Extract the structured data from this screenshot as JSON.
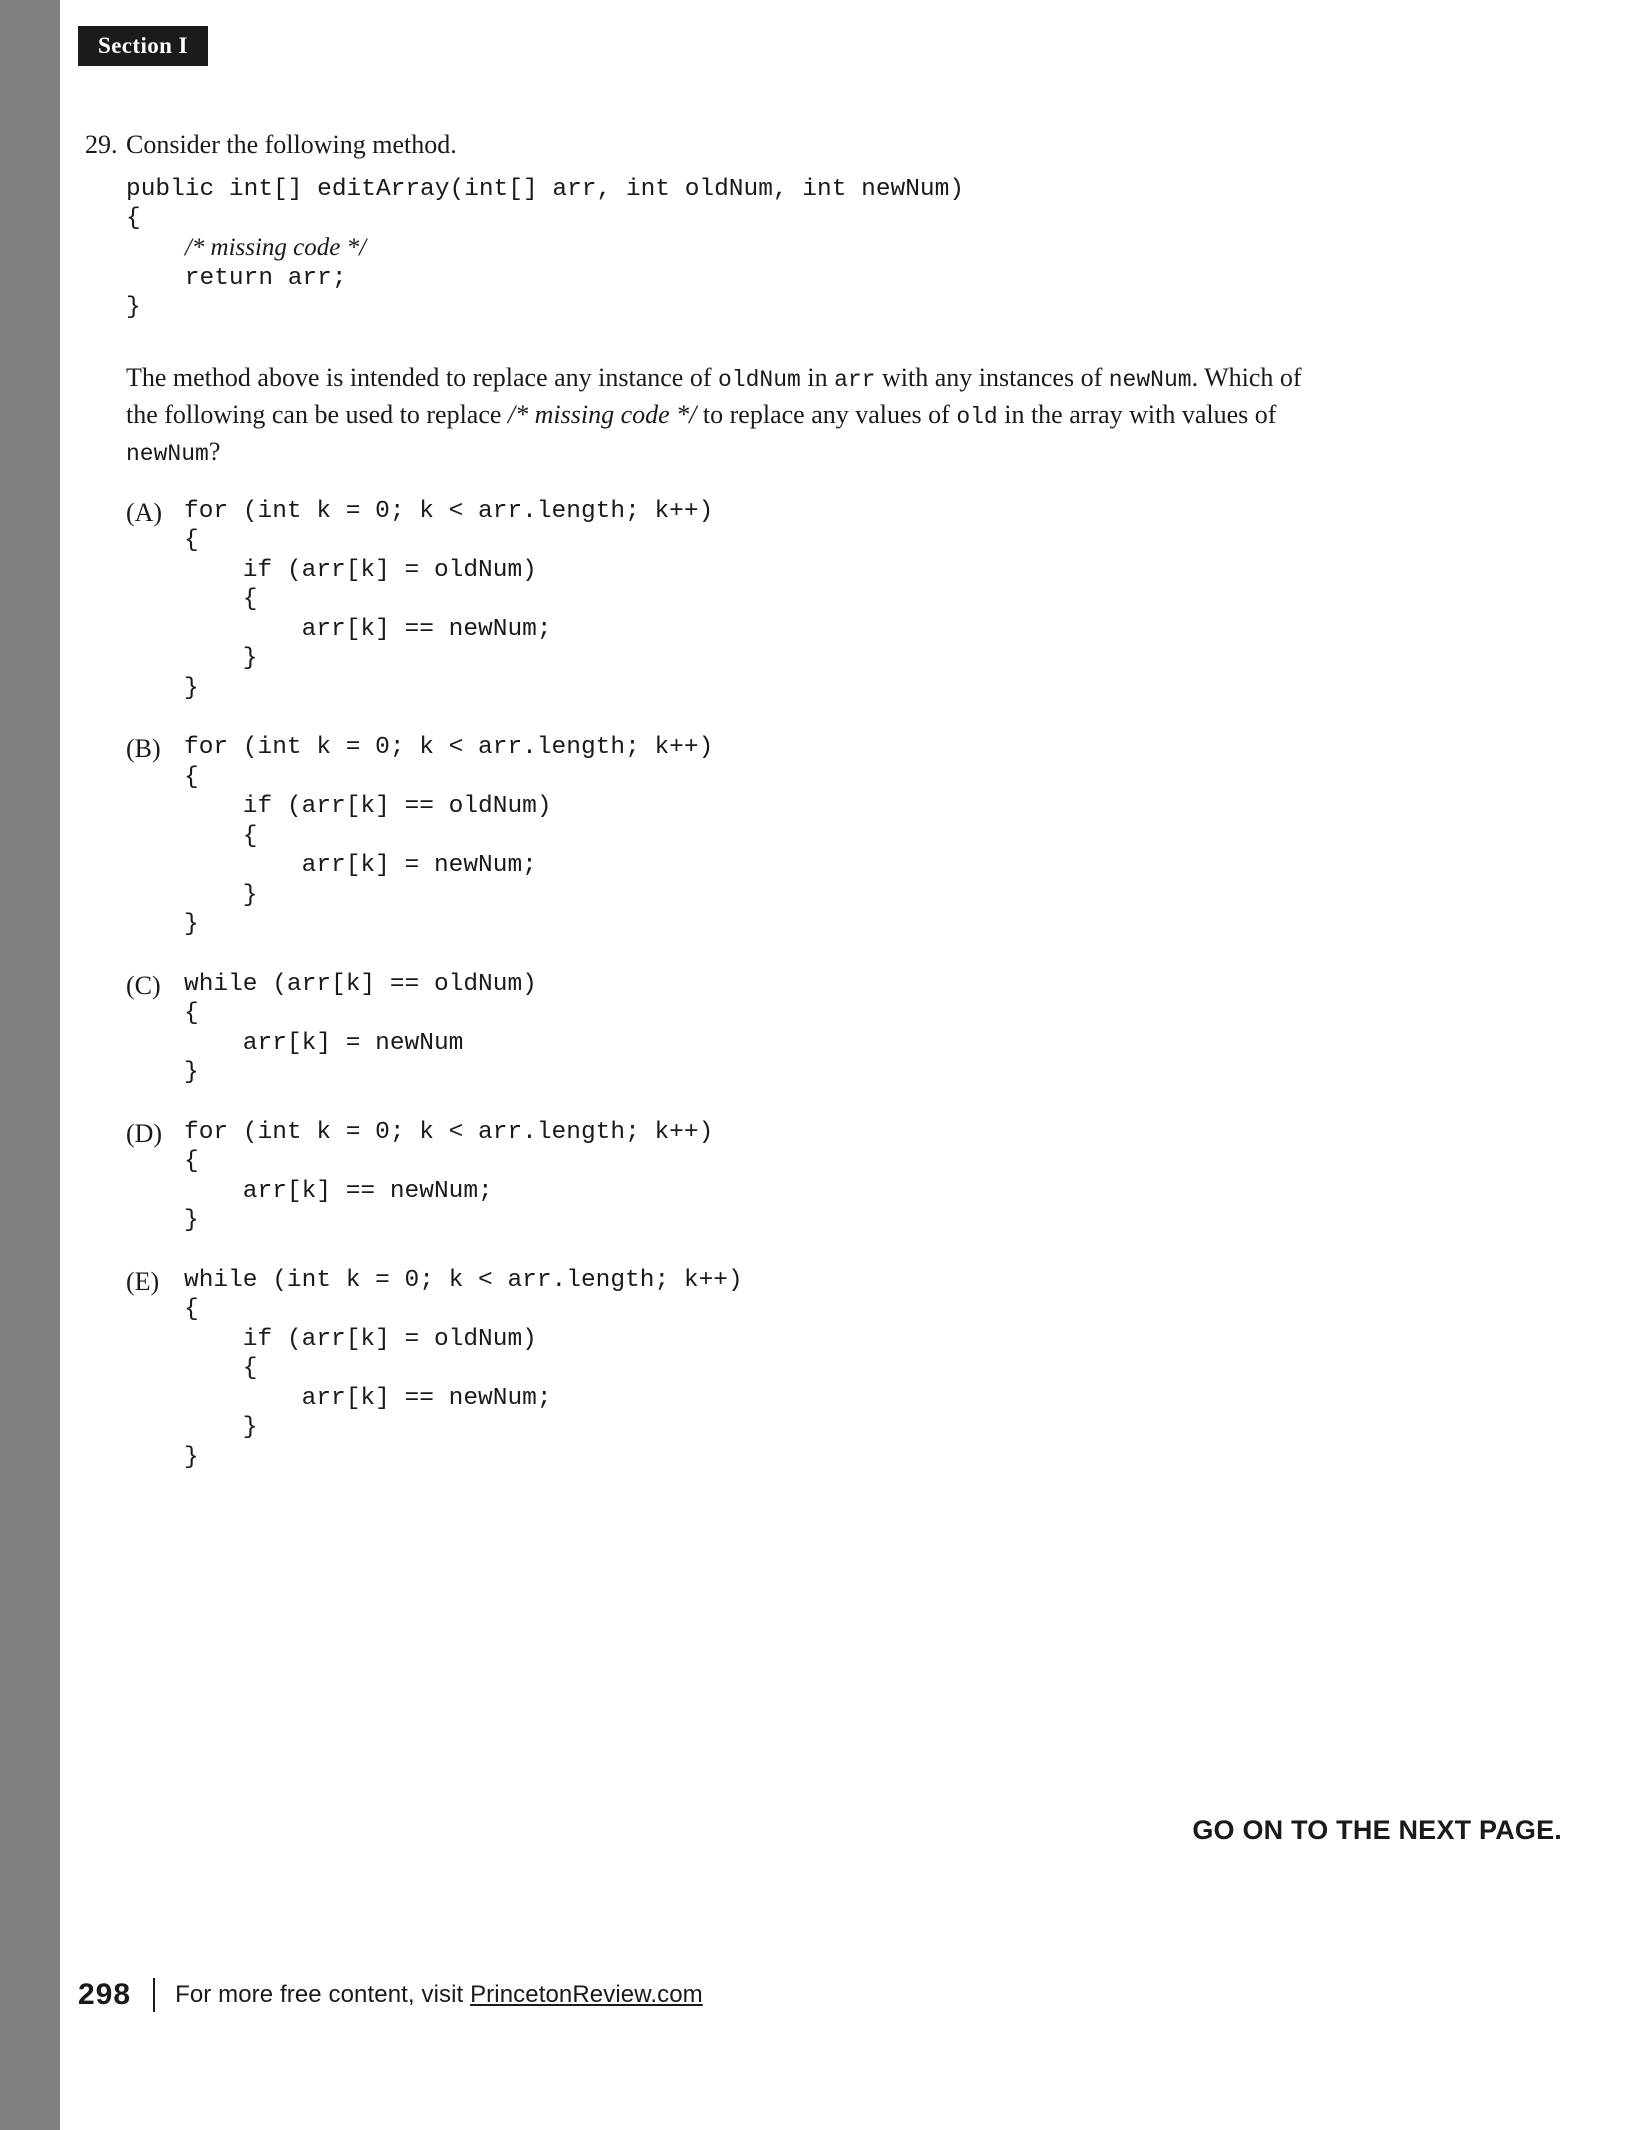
{
  "section_tab": "Section I",
  "question": {
    "number": "29.",
    "prompt": "Consider the following method.",
    "stem_code": {
      "line1": "public int[] editArray(int[] arr, int oldNum, int newNum)",
      "line2": "{",
      "comment": "/* missing code */",
      "line4": "    return arr;",
      "line5": "}"
    },
    "description": {
      "part1": "The method above is intended to replace any instance of ",
      "code1": "oldNum",
      "part2": " in ",
      "code2": "arr",
      "part3": " with any instances of ",
      "code3": "newNum",
      "part4": ". Which of the following can be used to replace ",
      "italic1": "/* missing code */",
      "part5": " to replace any values of ",
      "code4": "old",
      "part6": " in the array with values of ",
      "code5": "newNum",
      "part7": "?"
    }
  },
  "choices": [
    {
      "letter": "(A)",
      "code": "for (int k = 0; k < arr.length; k++)\n{\n    if (arr[k] = oldNum)\n    {\n        arr[k] == newNum;\n    }\n}"
    },
    {
      "letter": "(B)",
      "code": "for (int k = 0; k < arr.length; k++)\n{\n    if (arr[k] == oldNum)\n    {\n        arr[k] = newNum;\n    }\n}"
    },
    {
      "letter": "(C)",
      "code": "while (arr[k] == oldNum)\n{\n    arr[k] = newNum\n}"
    },
    {
      "letter": "(D)",
      "code": "for (int k = 0; k < arr.length; k++)\n{\n    arr[k] == newNum;\n}"
    },
    {
      "letter": "(E)",
      "code": "while (int k = 0; k < arr.length; k++)\n{\n    if (arr[k] = oldNum)\n    {\n        arr[k] == newNum;\n    }\n}"
    }
  ],
  "go_on_notice": "GO ON TO THE NEXT PAGE.",
  "footer": {
    "page_number": "298",
    "text_before": "For more free content, visit ",
    "link": "PrincetonReview.com"
  },
  "colors": {
    "margin_bar": "#808080",
    "section_tab_bg": "#1b1b1b",
    "text": "#1a1a1a"
  }
}
